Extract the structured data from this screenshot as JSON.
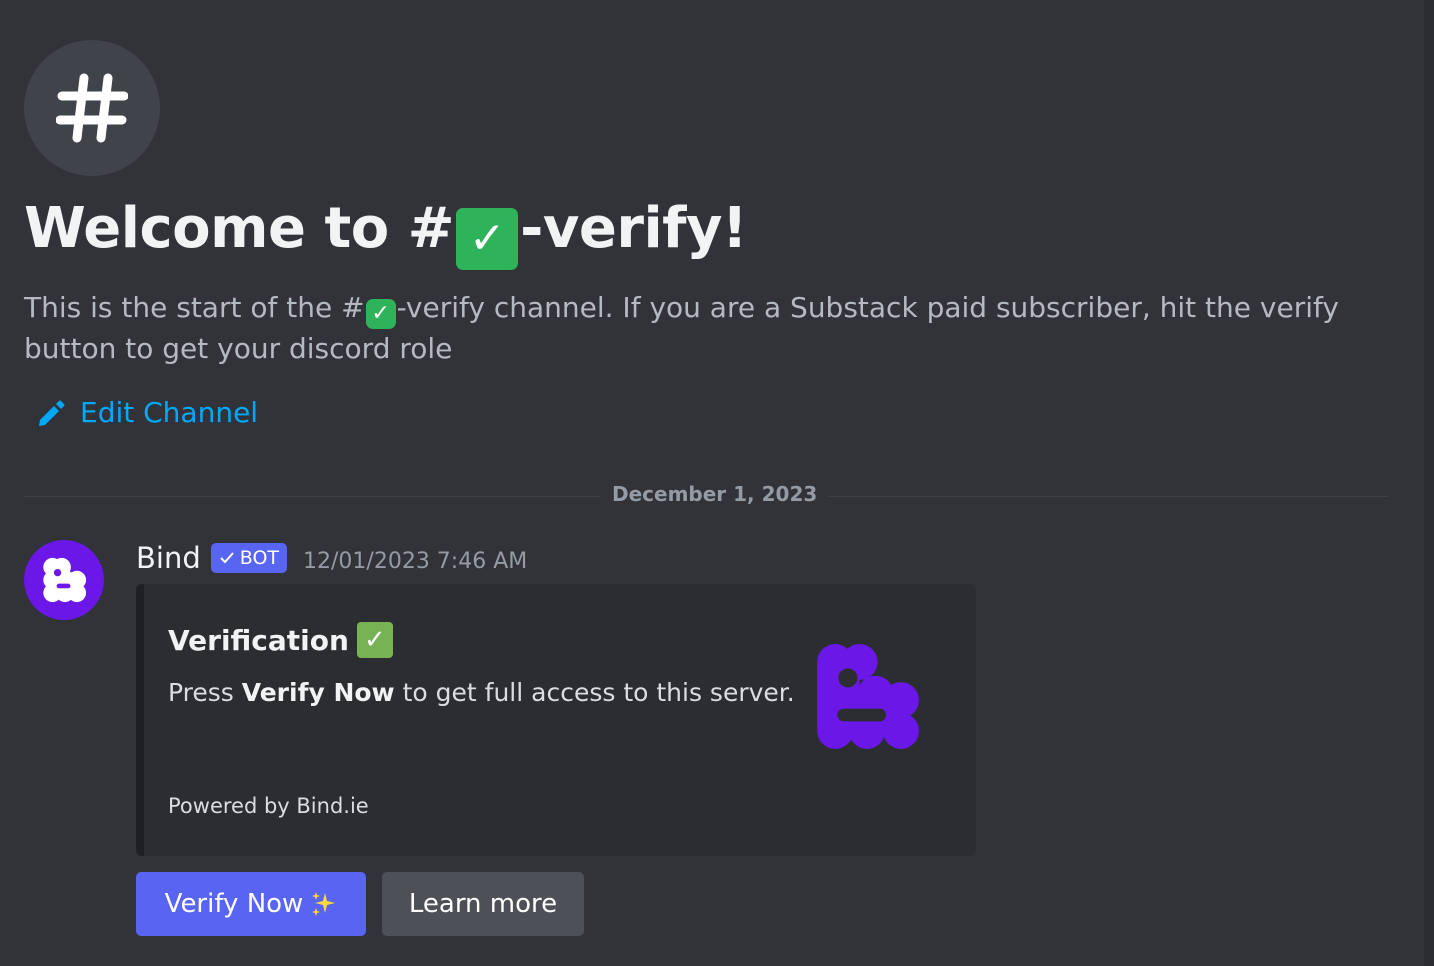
{
  "channel": {
    "name_suffix": "-verify",
    "title_prefix": "Welcome to #",
    "title_suffix": "-verify!",
    "desc_prefix": "This is the start of the #",
    "desc_suffix": "-verify channel. If you are a Substack paid subscriber, hit the verify button to get your discord role",
    "edit_label": "Edit Channel"
  },
  "divider": {
    "date": "December 1, 2023"
  },
  "message": {
    "author": "Bind",
    "bot_tag": "BOT",
    "timestamp": "12/01/2023 7:46 AM",
    "embed": {
      "title": "Verification",
      "desc_prefix": "Press ",
      "desc_bold": "Verify Now",
      "desc_suffix": " to get full access to this server.",
      "footer": "Powered by Bind.ie"
    },
    "buttons": {
      "verify_label": "Verify Now",
      "learn_label": "Learn more"
    }
  },
  "icons": {
    "channel": "hash-icon",
    "edit": "pencil-icon",
    "check": "check-mark-icon",
    "sparkles": "sparkles-icon",
    "avatar": "bind-logo-icon"
  },
  "colors": {
    "background": "#313338",
    "link": "#00a8fc",
    "blurple": "#5865f2",
    "bind_purple": "#6a17e8",
    "check_green": "#2fb35a"
  }
}
